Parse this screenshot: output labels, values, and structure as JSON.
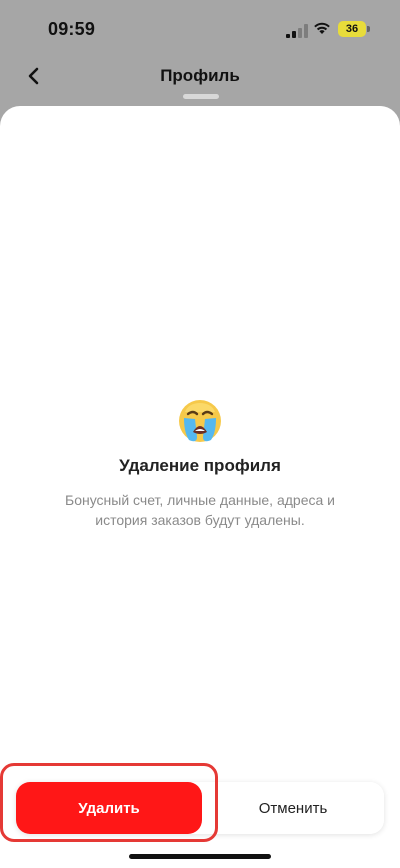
{
  "status_bar": {
    "time": "09:59",
    "battery_level": "36",
    "battery_color": "#e8dc3a",
    "signal_icon": "signal-bars-icon",
    "wifi_icon": "wifi-icon"
  },
  "header": {
    "title": "Профиль",
    "back_icon": "chevron-left-icon"
  },
  "dialog": {
    "emoji_icon": "crying-face-icon",
    "title": "Удаление профиля",
    "description": "Бонусный счет, личные данные, адреса и история заказов будут удалены."
  },
  "actions": {
    "delete_label": "Удалить",
    "cancel_label": "Отменить",
    "delete_color": "#ff1717",
    "highlight_color": "#e53935"
  }
}
